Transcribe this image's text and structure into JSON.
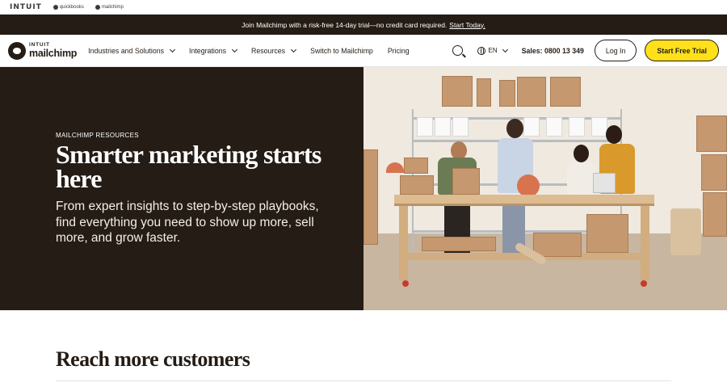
{
  "brand_strip": {
    "intuit": "INTUIT",
    "quickbooks": "quickbooks",
    "mailchimp": "mailchimp"
  },
  "promo": {
    "text": "Join Mailchimp with a risk-free 14-day trial—no credit card required.",
    "link": "Start Today."
  },
  "nav": {
    "logo_intuit": "INTUIT",
    "logo_mailchimp": "mailchimp",
    "items": [
      {
        "label": "Industries and Solutions",
        "dropdown": true
      },
      {
        "label": "Integrations",
        "dropdown": true
      },
      {
        "label": "Resources",
        "dropdown": true
      },
      {
        "label": "Switch to Mailchimp",
        "dropdown": false
      },
      {
        "label": "Pricing",
        "dropdown": false
      }
    ],
    "language": "EN",
    "sales": "Sales: 0800 13 349",
    "login": "Log In",
    "trial": "Start Free Trial"
  },
  "hero": {
    "eyebrow": "MAILCHIMP RESOURCES",
    "title": "Smarter marketing starts here",
    "subtitle": "From expert insights to step-by-step playbooks, find everything you need to show up more, sell more, and grow faster."
  },
  "section": {
    "title": "Reach more customers"
  },
  "colors": {
    "dark": "#241c15",
    "accent_yellow": "#ffe01b",
    "white": "#ffffff"
  }
}
